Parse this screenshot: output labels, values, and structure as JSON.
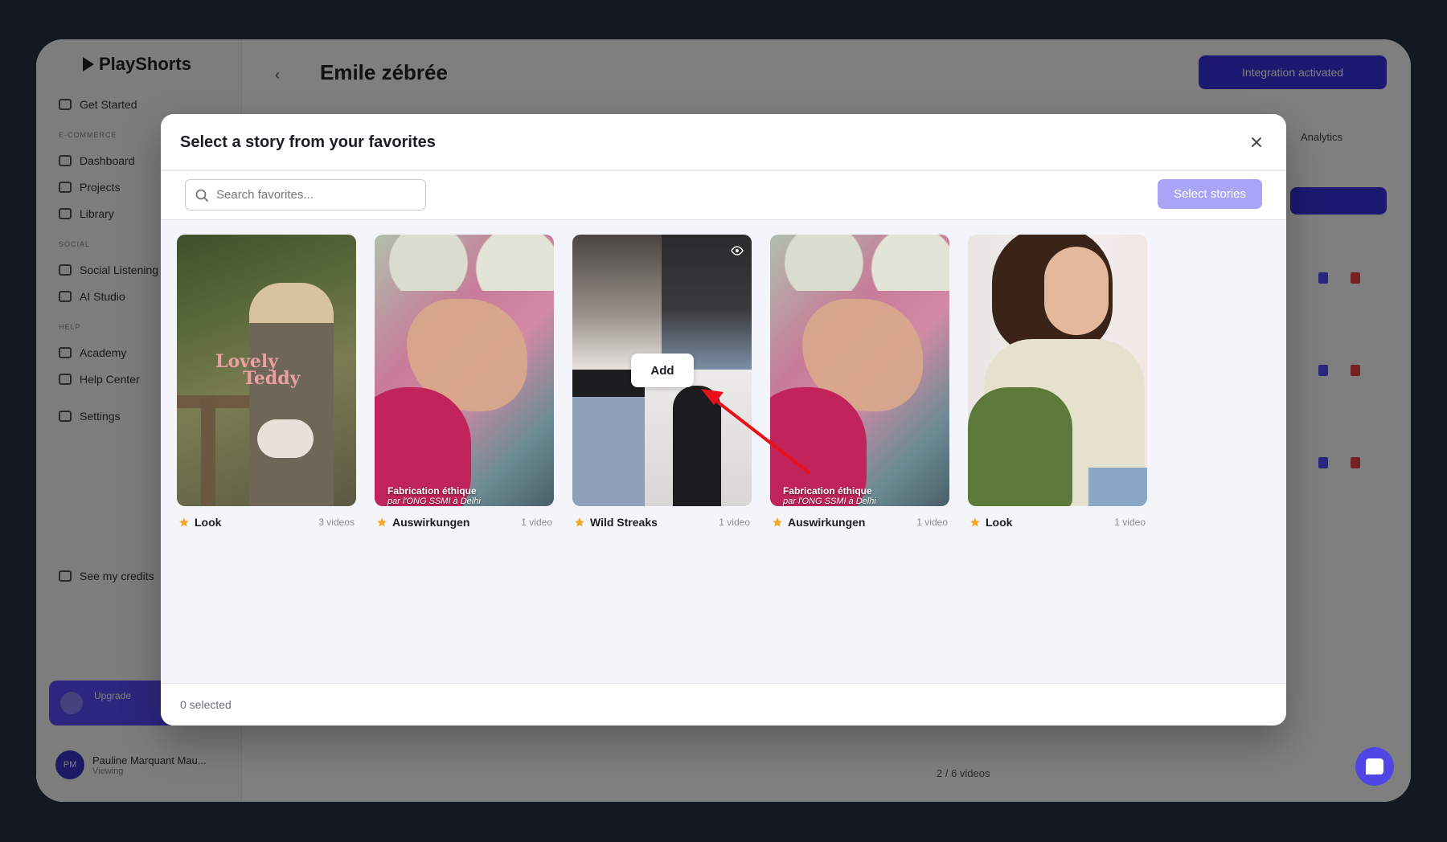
{
  "background_app": {
    "brand": "PlayShorts",
    "page_title": "Emile zébrée",
    "header_button": "Integration activated",
    "nav_group_1": "E-COMMERCE",
    "nav_group_2": "SOCIAL",
    "nav_group_3": "HELP",
    "nav_items": [
      "Get Started",
      "Dashboard",
      "Projects",
      "Library",
      "Social Listening",
      "AI Studio",
      "Academy",
      "Help Center",
      "Settings",
      "See my credits"
    ],
    "plan_label": "Upgrade",
    "user_name": "Pauline Marquant Mau...",
    "user_initials": "PM",
    "user_role": "Viewing",
    "analytics_label": "Analytics",
    "footer_text": "2 / 6 videos"
  },
  "modal": {
    "title": "Select a story from your favorites",
    "search_placeholder": "Search favorites...",
    "select_button": "Select stories",
    "selected_count": "0 selected",
    "hover_action": "Add",
    "cards": [
      {
        "title": "Look",
        "count": "3 videos",
        "overlay_line1": "Lovely",
        "overlay_line2": "Teddy"
      },
      {
        "title": "Auswirkungen",
        "count": "1 video",
        "caption_line1": "Fabrication éthique",
        "caption_line2": "par l'ONG SSMI à Delhi"
      },
      {
        "title": "Wild Streaks",
        "count": "1 video"
      },
      {
        "title": "Auswirkungen",
        "count": "1 video",
        "caption_line1": "Fabrication éthique",
        "caption_line2": "par l'ONG SSMI à Delhi"
      },
      {
        "title": "Look",
        "count": "1 video"
      }
    ]
  },
  "colors": {
    "accent": "#5b4dff",
    "select_button": "#a8a5f7",
    "star": "#f5a623",
    "annotation_arrow": "#e8101b"
  },
  "icons": {
    "close": "close-icon",
    "search": "search-icon",
    "star": "star-icon",
    "eye": "eye-icon",
    "chat": "chat-icon"
  }
}
